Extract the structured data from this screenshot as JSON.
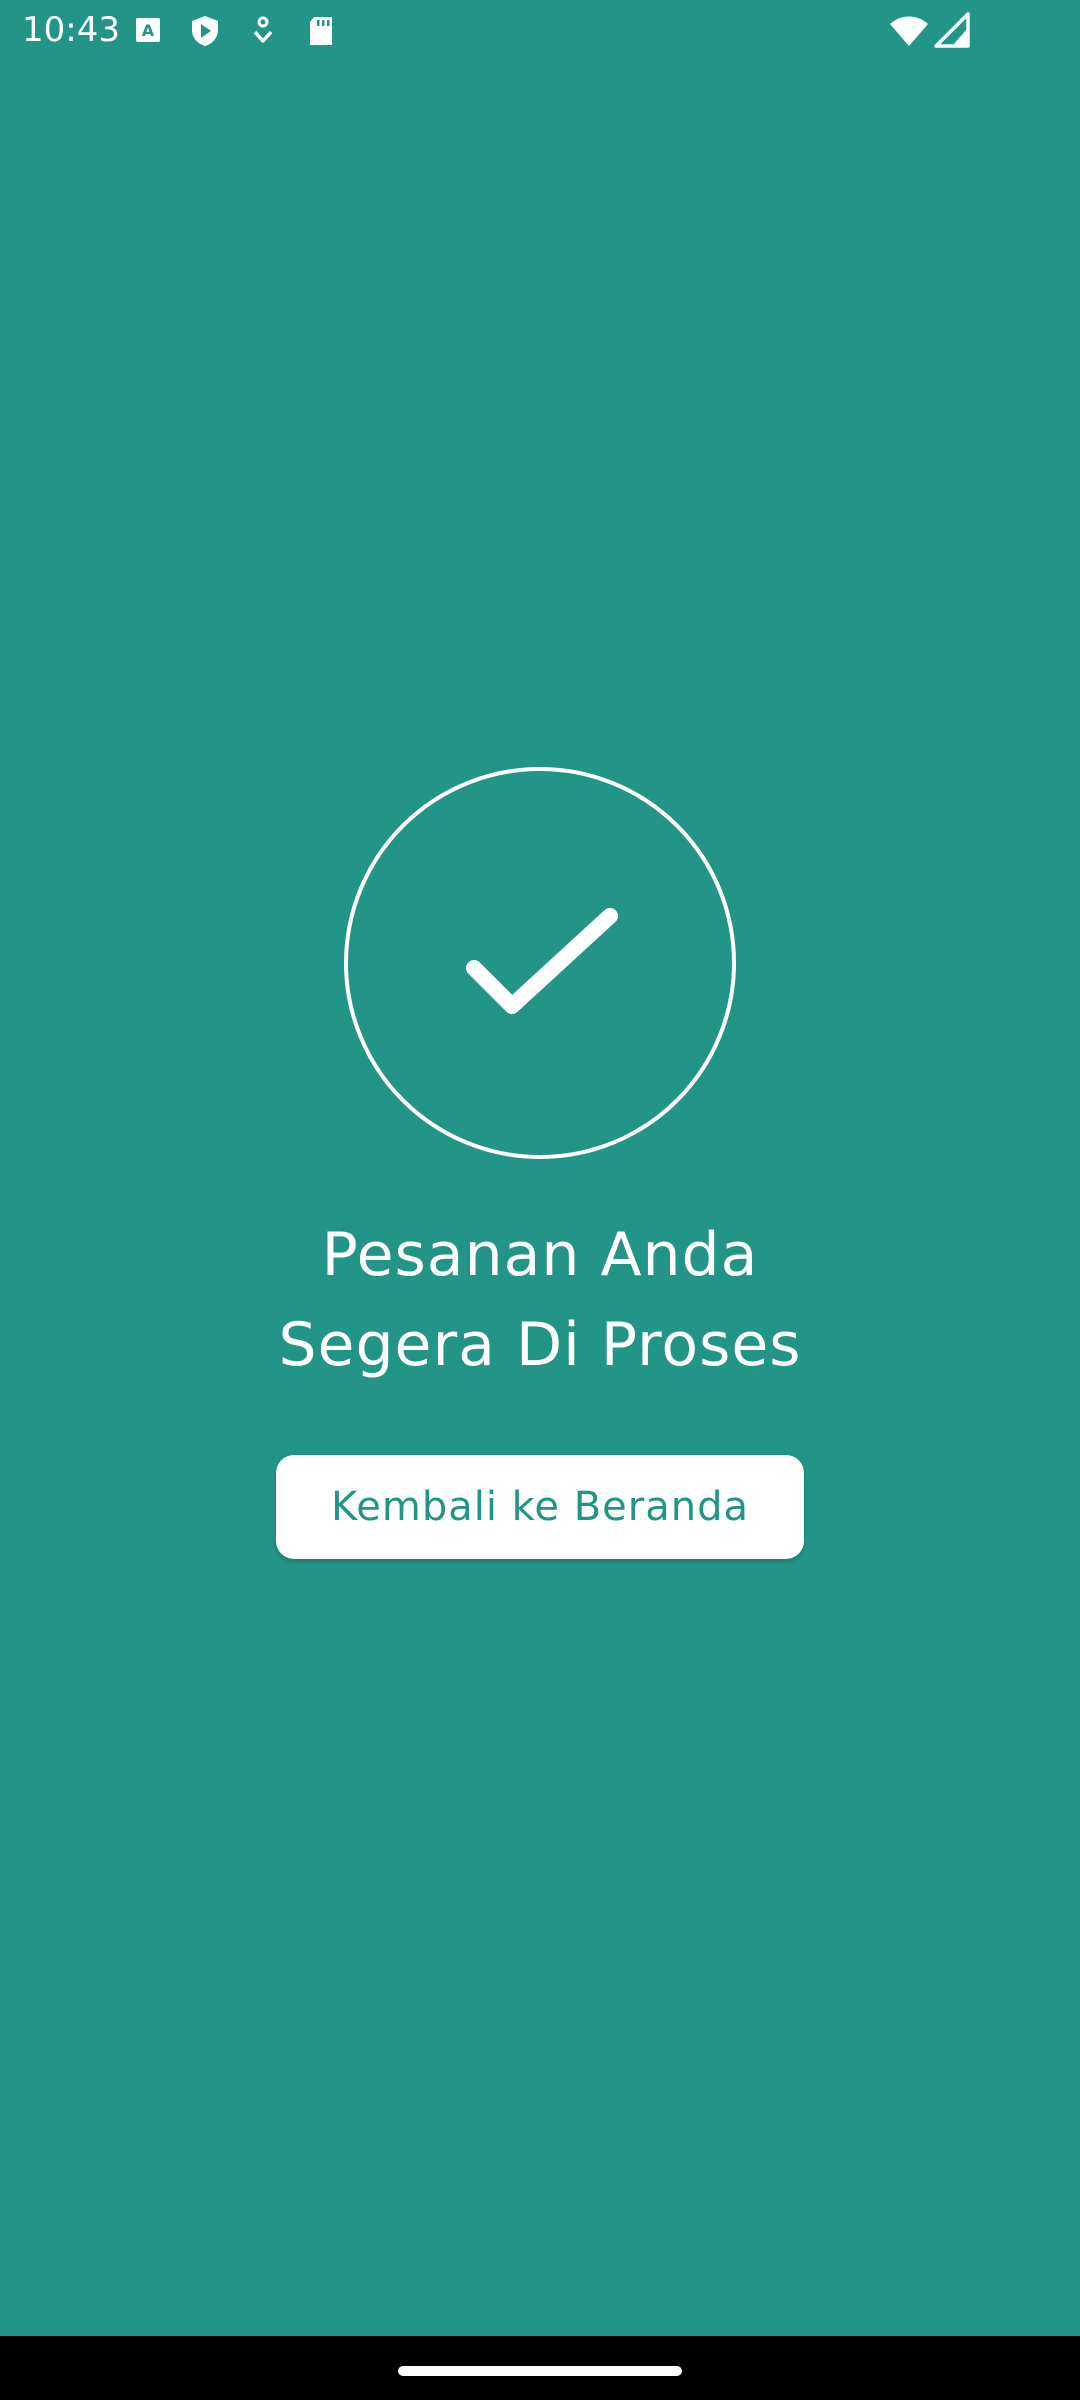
{
  "status_bar": {
    "time": "10:43",
    "icons": [
      "font-a-icon",
      "shield-play-icon",
      "download-badge-icon",
      "sd-card-icon",
      "wifi-icon",
      "signal-icon"
    ]
  },
  "success": {
    "icon": "check-icon",
    "message_line1": "Pesanan Anda",
    "message_line2": "Segera Di Proses"
  },
  "actions": {
    "home_label": "Kembali ke Beranda"
  },
  "colors": {
    "background": "#239587",
    "foreground": "#ffffff",
    "button_text": "#239587"
  }
}
